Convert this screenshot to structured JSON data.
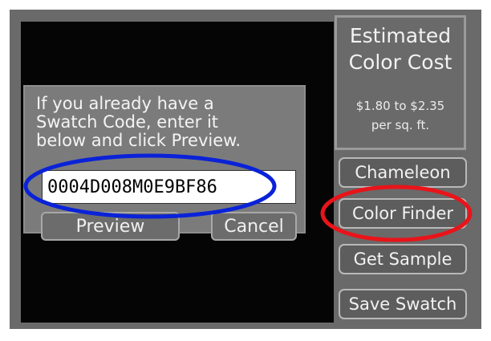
{
  "cost_panel": {
    "title": "Estimated\nColor Cost",
    "price": "$1.80 to $2.35\nper sq. ft."
  },
  "side_buttons": {
    "chameleon": "Chameleon",
    "color_finder": "Color Finder",
    "get_sample": "Get Sample",
    "save_swatch": "Save Swatch"
  },
  "dialog": {
    "message": "If you already have a\nSwatch Code, enter it\nbelow and click Preview.",
    "code_value": "0004D008M0E9BF86",
    "preview_label": "Preview",
    "cancel_label": "Cancel"
  },
  "annotations": {
    "blue_ellipse_color": "#0a22d8",
    "red_ellipse_color": "#e8141a"
  }
}
